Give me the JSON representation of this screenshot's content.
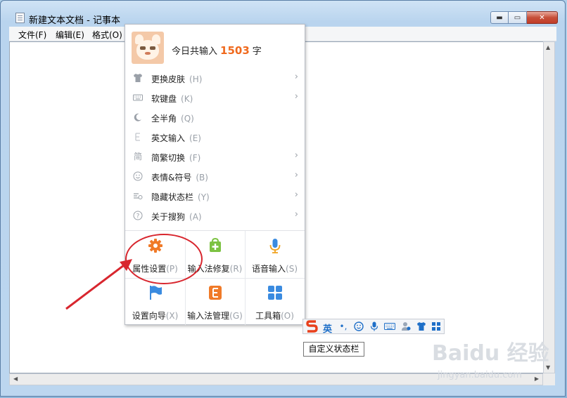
{
  "window": {
    "title": "新建文本文档 - 记事本",
    "controls": {
      "minimize": "▬",
      "maximize": "▭",
      "close": "✕"
    }
  },
  "menubar": {
    "items": [
      "文件(F)",
      "编辑(E)",
      "格式(O)"
    ]
  },
  "ime_popup": {
    "greeting_prefix": "今日共输入",
    "count": "1503",
    "greeting_suffix": "字",
    "items": [
      {
        "icon": "shirt-icon",
        "label": "更换皮肤",
        "hotkey": "(H)",
        "submenu": true
      },
      {
        "icon": "keyboard-icon",
        "label": "软键盘",
        "hotkey": "(K)",
        "submenu": true
      },
      {
        "icon": "moon-icon",
        "label": "全半角",
        "hotkey": "(Q)",
        "submenu": false
      },
      {
        "icon": "letter-e-icon",
        "label": "英文输入",
        "hotkey": "(E)",
        "submenu": false
      },
      {
        "icon": "jian-char-icon",
        "label": "简繁切换",
        "hotkey": "(F)",
        "submenu": true
      },
      {
        "icon": "smiley-icon",
        "label": "表情&符号",
        "hotkey": "(B)",
        "submenu": true
      },
      {
        "icon": "hide-bar-icon",
        "label": "隐藏状态栏",
        "hotkey": "(Y)",
        "submenu": true
      },
      {
        "icon": "question-icon",
        "label": "关于搜狗",
        "hotkey": "(A)",
        "submenu": true
      }
    ],
    "grid": [
      {
        "icon": "gear-icon",
        "label": "属性设置",
        "hotkey": "(P)",
        "color": "#f07a28"
      },
      {
        "icon": "repair-bag-icon",
        "label": "输入法修复",
        "hotkey": "(R)",
        "color": "#7cc242"
      },
      {
        "icon": "microphone-icon",
        "label": "语音输入",
        "hotkey": "(S)",
        "color": "#3a8be0"
      },
      {
        "icon": "flag-icon",
        "label": "设置向导",
        "hotkey": "(X)",
        "color": "#3a8be0"
      },
      {
        "icon": "manager-icon",
        "label": "输入法管理",
        "hotkey": "(G)",
        "color": "#f07a28"
      },
      {
        "icon": "toolbox-icon",
        "label": "工具箱",
        "hotkey": "(O)",
        "color": "#3a8be0"
      }
    ]
  },
  "ime_statusbar": {
    "mode": "英",
    "icons": [
      "punct-icon",
      "smiley-icon",
      "microphone-icon",
      "keyboard-icon",
      "user-icon",
      "shirt-icon",
      "toolbox-icon"
    ]
  },
  "tooltip": "自定义状态栏",
  "watermark": {
    "main": "Baidu 经验",
    "sub": "jingyan.baidu.com"
  },
  "colors": {
    "accent": "#f06a1e",
    "annotation": "#d8262e",
    "ime_blue": "#1e6fc8"
  }
}
